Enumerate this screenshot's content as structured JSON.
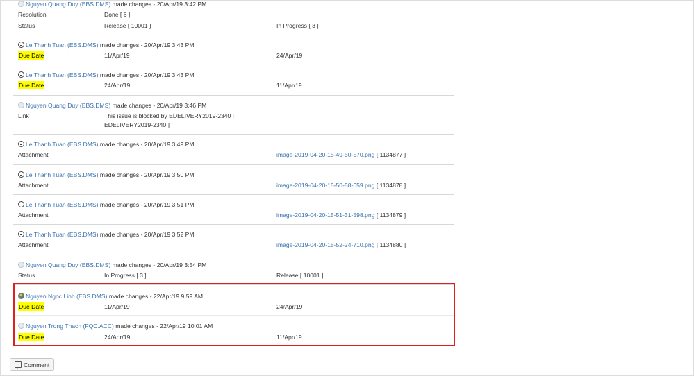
{
  "action_text": "made changes -",
  "entries": [
    {
      "author": "Nguyen Quang Duy (EBS.DMS)",
      "date": "20/Apr/19 3:42 PM",
      "items": [
        {
          "field": "Resolution",
          "old": "Done [ 6 ]",
          "new": ""
        },
        {
          "field": "Status",
          "old": "Release [ 10001 ]",
          "new": "In Progress [ 3 ]"
        }
      ]
    },
    {
      "author": "Le Thanh Tuan (EBS.DMS)",
      "date": "20/Apr/19 3:43 PM",
      "items": [
        {
          "field": "Due Date",
          "old": "11/Apr/19",
          "new": "24/Apr/19"
        }
      ]
    },
    {
      "author": "Le Thanh Tuan (EBS.DMS)",
      "date": "20/Apr/19 3:43 PM",
      "items": [
        {
          "field": "Due Date",
          "old": "24/Apr/19",
          "new": "11/Apr/19"
        }
      ]
    },
    {
      "author": "Nguyen Quang Duy (EBS.DMS)",
      "date": "20/Apr/19 3:46 PM",
      "items": [
        {
          "field": "Link",
          "old_line1": "This issue is blocked by EDELIVERY2019-2340 [",
          "old_line2": "EDELIVERY2019-2340 ]"
        }
      ]
    },
    {
      "author": "Le Thanh Tuan (EBS.DMS)",
      "date": "20/Apr/19 3:49 PM",
      "items": [
        {
          "field": "Attachment",
          "file": "image-2019-04-20-15-49-50-570.png",
          "id": "[ 1134877 ]"
        }
      ]
    },
    {
      "author": "Le Thanh Tuan (EBS.DMS)",
      "date": "20/Apr/19 3:50 PM",
      "items": [
        {
          "field": "Attachment",
          "file": "image-2019-04-20-15-50-58-659.png",
          "id": "[ 1134878 ]"
        }
      ]
    },
    {
      "author": "Le Thanh Tuan (EBS.DMS)",
      "date": "20/Apr/19 3:51 PM",
      "items": [
        {
          "field": "Attachment",
          "file": "image-2019-04-20-15-51-31-598.png",
          "id": "[ 1134879 ]"
        }
      ]
    },
    {
      "author": "Le Thanh Tuan (EBS.DMS)",
      "date": "20/Apr/19 3:52 PM",
      "items": [
        {
          "field": "Attachment",
          "file": "image-2019-04-20-15-52-24-710.png",
          "id": "[ 1134880 ]"
        }
      ]
    },
    {
      "author": "Nguyen Quang Duy (EBS.DMS)",
      "date": "20/Apr/19 3:54 PM",
      "items": [
        {
          "field": "Status",
          "old": "In Progress [ 3 ]",
          "new": "Release [ 10001 ]"
        }
      ]
    },
    {
      "author": "Nguyen Ngoc Linh (EBS.DMS)",
      "date": "22/Apr/19 9:59 AM",
      "items": [
        {
          "field": "Due Date",
          "old": "11/Apr/19",
          "new": "24/Apr/19"
        }
      ]
    },
    {
      "author": "Nguyen Trong Thach (FQC.ACC)",
      "date": "22/Apr/19 10:01 AM",
      "items": [
        {
          "field": "Due Date",
          "old": "24/Apr/19",
          "new": "11/Apr/19"
        }
      ]
    }
  ],
  "comment_button": "Comment",
  "colors": {
    "link": "#3b73af",
    "highlight": "#ffff00",
    "annotation_box": "#e02020"
  },
  "icons": {
    "default_avatar": "default-avatar-icon",
    "face_avatar": "face-avatar-icon",
    "photo_avatar": "photo-avatar-icon",
    "comment": "comment-icon"
  }
}
